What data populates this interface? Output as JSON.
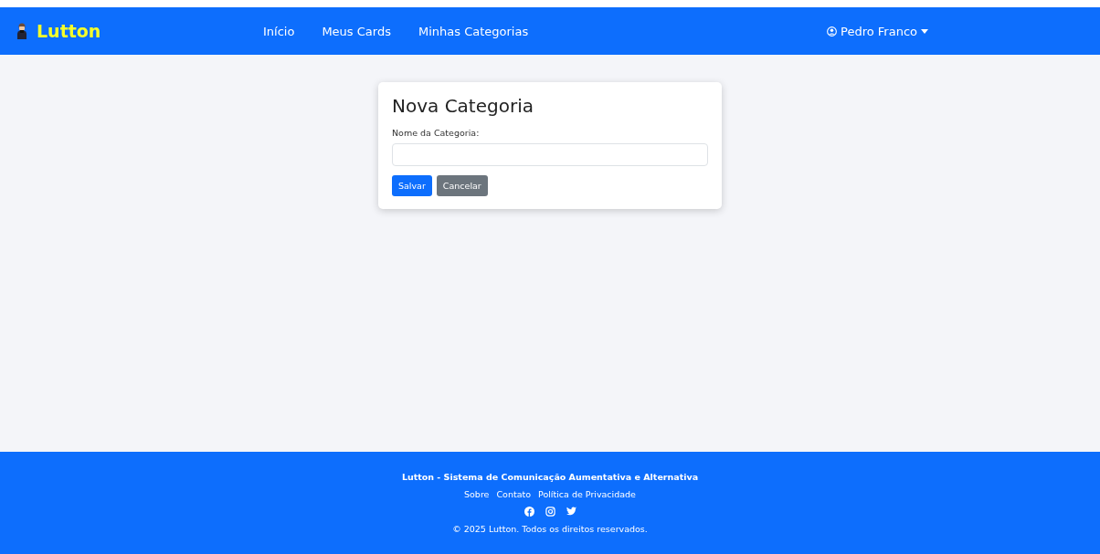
{
  "navbar": {
    "brand": "Lutton",
    "links": [
      {
        "label": "Início"
      },
      {
        "label": "Meus Cards"
      },
      {
        "label": "Minhas Categorias"
      }
    ],
    "user": "Pedro Franco"
  },
  "form": {
    "title": "Nova Categoria",
    "field_label": "Nome da Categoria:",
    "buttons": [
      {
        "label": "Salvar",
        "kind": "primary"
      },
      {
        "label": "Cancelar",
        "kind": "secondary"
      }
    ]
  },
  "footer": {
    "title": "Lutton - Sistema de Comunicação Aumentativa e Alternativa",
    "links": [
      "Sobre",
      "Contato",
      "Política de Privacidade"
    ],
    "social": [
      {
        "kind": "facebook"
      },
      {
        "kind": "instagram"
      },
      {
        "kind": "twitter"
      }
    ],
    "copyright": "© 2025 Lutton. Todos os direitos reservados."
  }
}
